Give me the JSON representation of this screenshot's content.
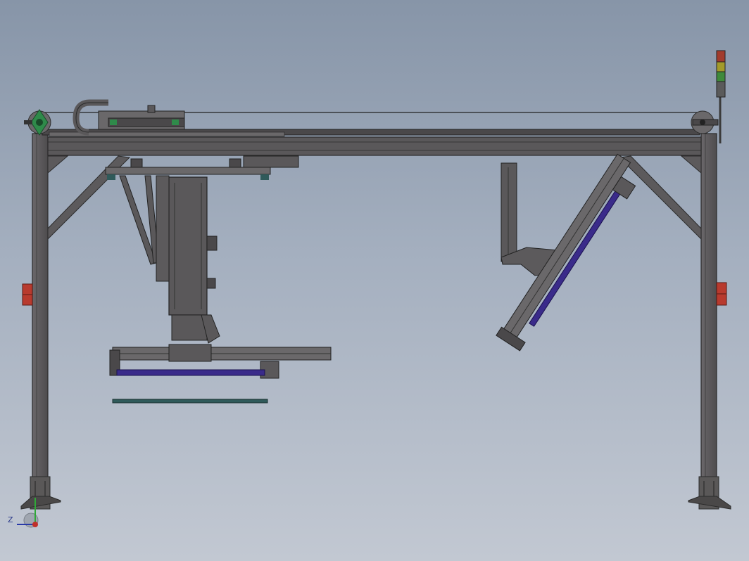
{
  "viewport": {
    "background_top": "#8795a8",
    "background_bottom": "#c2c8d2",
    "frame_color": "#5c5a5c",
    "frame_edge": "#2b2b2b",
    "rail_color": "#4d4b4d",
    "accent_purple": "#3a2b8a",
    "accent_green": "#2f8a4a",
    "accent_red": "#b83a2e",
    "accent_teal": "#2f5a5a"
  },
  "triad": {
    "axis_label": "Z",
    "x_axis_color": "#c0302a",
    "y_axis_color": "#2fa838",
    "z_axis_color": "#2a3aa8"
  },
  "signal_tower": {
    "lights": [
      "red",
      "yellow",
      "green",
      "gray"
    ],
    "light_colors": [
      "#a23b2c",
      "#a39a2a",
      "#3f8a3a",
      "#5a5a5a"
    ]
  }
}
